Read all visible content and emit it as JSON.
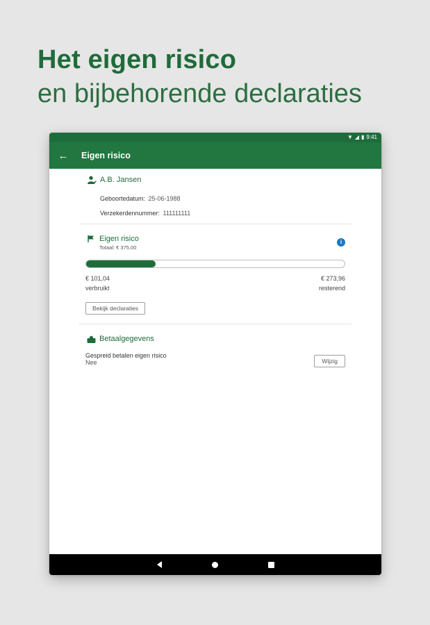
{
  "headline": {
    "line1": "Het eigen risico",
    "line2": "en bijbehorende declaraties"
  },
  "statusbar": {
    "time": "9:41"
  },
  "appbar": {
    "title": "Eigen risico"
  },
  "person": {
    "name": "A.B. Jansen",
    "birthdate_label": "Geboortedatum:",
    "birthdate": "25-06-1988",
    "insured_label": "Verzekerdennummer:",
    "insured_number": "111111111"
  },
  "risk": {
    "title": "Eigen risico",
    "total": "Totaal: € 375,00",
    "used_amount": "€ 101,04",
    "used_label": "verbruikt",
    "remaining_amount": "€ 273,96",
    "remaining_label": "resterend",
    "progress_fraction": 0.27,
    "button_label": "Bekijk declaraties"
  },
  "payment": {
    "title": "Betaalgegevens",
    "setting_label": "Gespreid betalen eigen risico",
    "setting_value": "Nee",
    "button_label": "Wijzig"
  },
  "colors": {
    "brand_green": "#22763f",
    "info_blue": "#1b78c3"
  }
}
